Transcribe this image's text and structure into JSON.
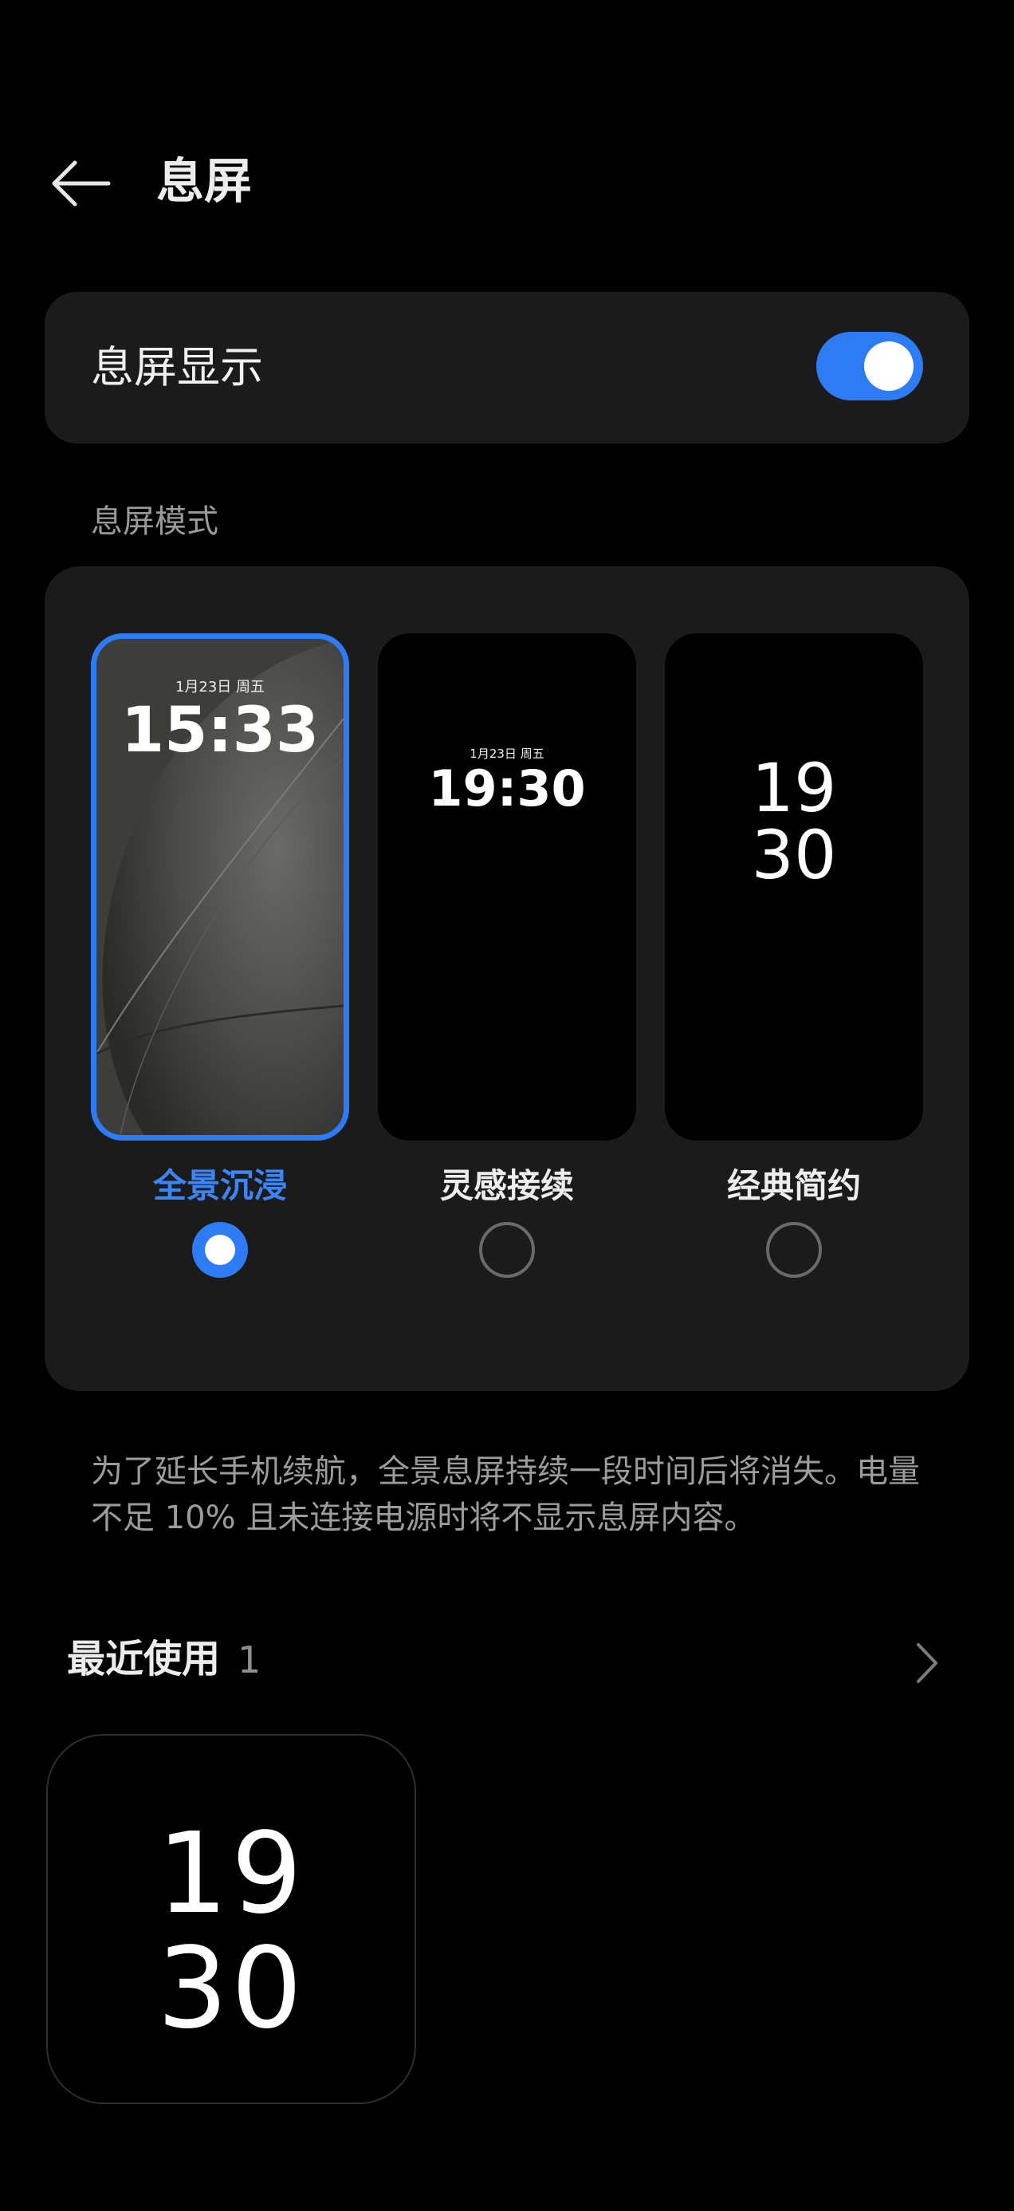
{
  "header": {
    "title": "息屏",
    "back_icon": "arrow-left-icon"
  },
  "aod_toggle": {
    "label": "息屏显示",
    "enabled": true,
    "accent_color": "#2d7cf6"
  },
  "mode_section": {
    "label": "息屏模式",
    "options": [
      {
        "label": "全景沉浸",
        "selected": true,
        "preview_date": "1月23日 周五",
        "preview_time": "15:33"
      },
      {
        "label": "灵感接续",
        "selected": false,
        "preview_date": "1月23日 周五",
        "preview_time": "19:30"
      },
      {
        "label": "经典简约",
        "selected": false,
        "preview_hour": "19",
        "preview_minute": "30"
      }
    ]
  },
  "description": "为了延长手机续航，全景息屏持续一段时间后将消失。电量不足 10% 且未连接电源时将不显示息屏内容。",
  "recent": {
    "title": "最近使用",
    "count": "1",
    "chevron_icon": "chevron-right-icon",
    "items": [
      {
        "hour": "19",
        "minute": "30"
      }
    ]
  }
}
